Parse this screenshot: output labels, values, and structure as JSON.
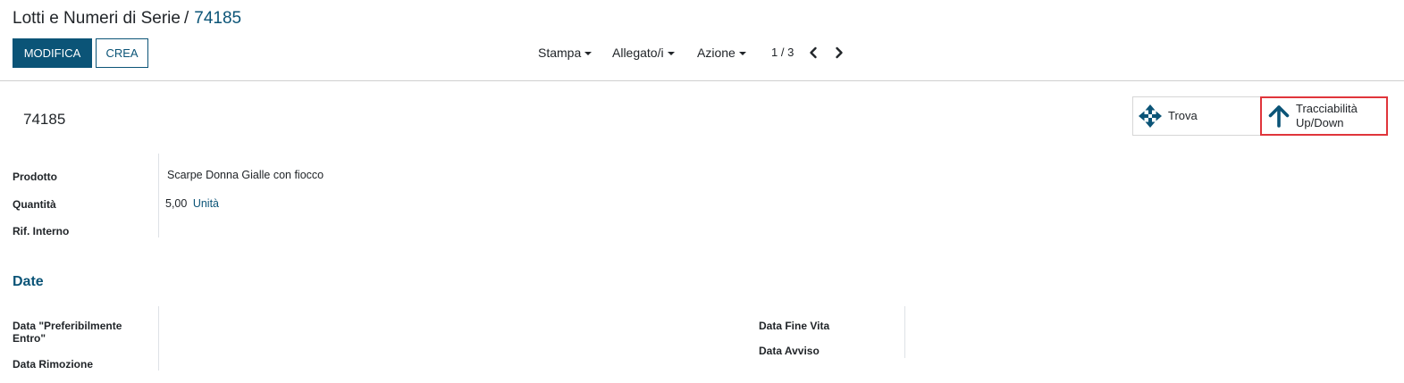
{
  "breadcrumb": {
    "parent": "Lotti e Numeri di Serie",
    "separator": "/",
    "current": "74185"
  },
  "buttons": {
    "edit": "MODIFICA",
    "create": "CREA"
  },
  "menus": {
    "print": "Stampa",
    "attachments": "Allegato/i",
    "action": "Azione"
  },
  "pager": {
    "value": "1 / 3"
  },
  "smart_buttons": {
    "find": "Trova",
    "traceability": "Tracciabilità Up/Down"
  },
  "record": {
    "name": "74185"
  },
  "fields": {
    "product_label": "Prodotto",
    "product_value": "Scarpe Donna Gialle con fiocco",
    "quantity_label": "Quantità",
    "quantity_value": "5,00",
    "quantity_uom": "Unità",
    "ref_label": "Rif. Interno"
  },
  "dates_section": {
    "title": "Date",
    "best_before_label": "Data \"Preferibilmente Entro\"",
    "removal_label": "Data Rimozione",
    "end_of_life_label": "Data Fine Vita",
    "alert_label": "Data Avviso"
  },
  "colors": {
    "accent": "#0b5477",
    "highlight": "#e0353b"
  }
}
